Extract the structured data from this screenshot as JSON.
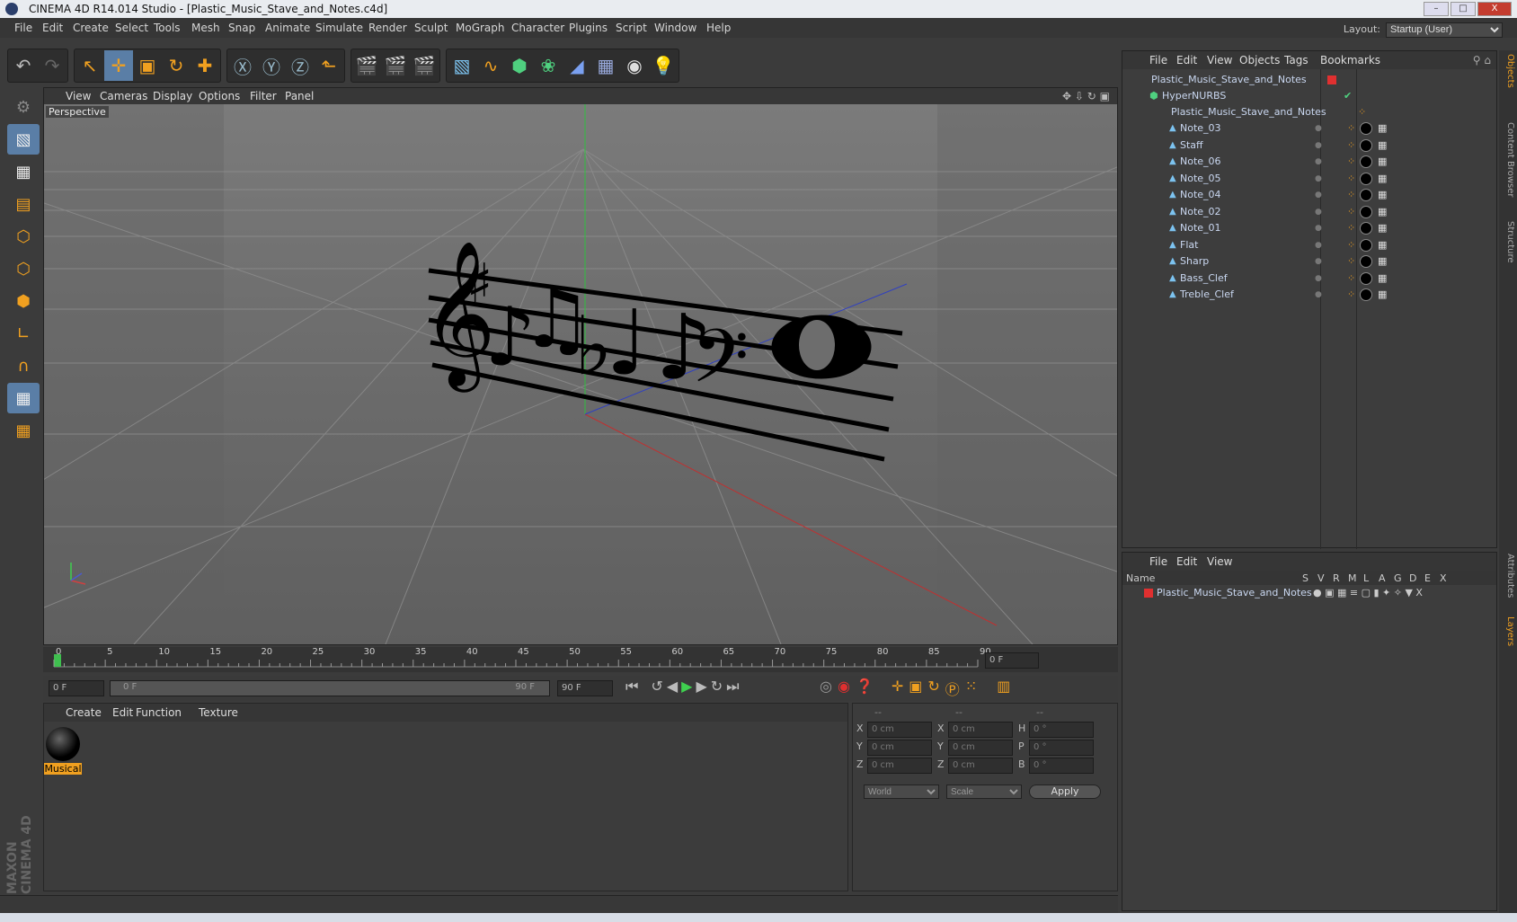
{
  "window": {
    "title": "CINEMA 4D R14.014 Studio - [Plastic_Music_Stave_and_Notes.c4d]",
    "min": "–",
    "max": "□",
    "close": "X"
  },
  "menubar": {
    "items": [
      "File",
      "Edit",
      "Create",
      "Select",
      "Tools",
      "Mesh",
      "Snap",
      "Animate",
      "Simulate",
      "Render",
      "Sculpt",
      "MoGraph",
      "Character",
      "Plugins",
      "Script",
      "Window",
      "Help"
    ],
    "layout_label": "Layout:",
    "layout_value": "Startup (User)"
  },
  "viewport": {
    "menu": [
      "View",
      "Cameras",
      "Display",
      "Options",
      "Filter",
      "Panel"
    ],
    "label": "Perspective"
  },
  "timeline": {
    "ticks": [
      "0",
      "5",
      "10",
      "15",
      "20",
      "25",
      "30",
      "35",
      "40",
      "45",
      "50",
      "55",
      "60",
      "65",
      "70",
      "75",
      "80",
      "85",
      "90"
    ],
    "frame_field": "0 F",
    "start": "0 F",
    "range_start": "0 F",
    "range_end": "90 F",
    "end": "90 F"
  },
  "materials": {
    "menu": [
      "Create",
      "Edit",
      "Function",
      "Texture"
    ],
    "item": "Musical"
  },
  "coords": {
    "headers": [
      "--",
      "--",
      "--"
    ],
    "rows": [
      {
        "a": "X",
        "av": "0 cm",
        "b": "X",
        "bv": "0 cm",
        "c": "H",
        "cv": "0 °"
      },
      {
        "a": "Y",
        "av": "0 cm",
        "b": "Y",
        "bv": "0 cm",
        "c": "P",
        "cv": "0 °"
      },
      {
        "a": "Z",
        "av": "0 cm",
        "b": "Z",
        "bv": "0 cm",
        "c": "B",
        "cv": "0 °"
      }
    ],
    "world": "World",
    "scale": "Scale",
    "apply": "Apply"
  },
  "objects": {
    "menu": [
      "File",
      "Edit",
      "View",
      "Objects",
      "Tags",
      "Bookmarks"
    ],
    "root": "Plastic_Music_Stave_and_Notes",
    "nurbs": "HyperNURBS",
    "group": "Plastic_Music_Stave_and_Notes",
    "children": [
      "Note_03",
      "Staff",
      "Note_06",
      "Note_05",
      "Note_04",
      "Note_02",
      "Note_01",
      "Flat",
      "Sharp",
      "Bass_Clef",
      "Treble_Clef"
    ]
  },
  "layers": {
    "menu": [
      "File",
      "Edit",
      "View"
    ],
    "col_name": "Name",
    "cols": [
      "S",
      "V",
      "R",
      "M",
      "L",
      "A",
      "G",
      "D",
      "E",
      "X"
    ],
    "row": "Plastic_Music_Stave_and_Notes"
  },
  "sidetabs": [
    "Objects",
    "Content Browser",
    "Structure",
    "Attributes",
    "Layers"
  ],
  "brand": "MAXON CINEMA 4D",
  "colors": {
    "accent": "#f0a020",
    "selection": "#5a7ea6",
    "red_layer": "#e03030"
  }
}
